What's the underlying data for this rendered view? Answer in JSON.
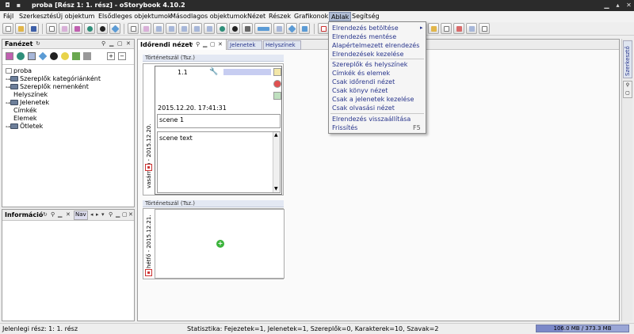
{
  "window": {
    "title": "proba [Rész 1: 1. rész] - oStorybook 4.10.2"
  },
  "menubar": {
    "items": [
      "Fájl",
      "Szerkesztés",
      "Új objektum",
      "Elsődleges objektumok",
      "Másodlagos objektumok",
      "Nézet",
      "Részek",
      "Grafikonok",
      "Ablak",
      "Segítség"
    ],
    "active": "Ablak"
  },
  "ablak_menu": {
    "items": [
      {
        "label": "Elrendezés betöltése",
        "submenu": true,
        "shortcut": ""
      },
      {
        "label": "Elrendezés mentése",
        "submenu": false,
        "shortcut": ""
      },
      {
        "label": "Alapértelmezett elrendezés",
        "submenu": false,
        "shortcut": ""
      },
      {
        "label": "Elrendezések kezelése",
        "submenu": false,
        "shortcut": ""
      },
      {
        "label": "Szereplők és helyszínek",
        "submenu": false,
        "shortcut": ""
      },
      {
        "label": "Címkék és elemek",
        "submenu": false,
        "shortcut": ""
      },
      {
        "label": "Csak időrendi nézet",
        "submenu": false,
        "shortcut": ""
      },
      {
        "label": "Csak könyv nézet",
        "submenu": false,
        "shortcut": ""
      },
      {
        "label": "Csak a jelenetek kezelése",
        "submenu": false,
        "shortcut": ""
      },
      {
        "label": "Csak olvasási nézet",
        "submenu": false,
        "shortcut": ""
      },
      {
        "label": "Elrendezés visszaállítása",
        "submenu": false,
        "shortcut": ""
      },
      {
        "label": "Frissítés",
        "submenu": false,
        "shortcut": "F5"
      }
    ]
  },
  "left_panel": {
    "title": "Fanézet",
    "tree": [
      {
        "label": "proba",
        "folder": false,
        "expander": false
      },
      {
        "label": "Szereplők kategóriánként",
        "folder": true,
        "expander": true
      },
      {
        "label": "Szereplők nemenként",
        "folder": true,
        "expander": true
      },
      {
        "label": "Helyszínek",
        "folder": false,
        "expander": false
      },
      {
        "label": "Jelenetek",
        "folder": true,
        "expander": true
      },
      {
        "label": "Címkék",
        "folder": false,
        "expander": false
      },
      {
        "label": "Elemek",
        "folder": false,
        "expander": false
      },
      {
        "label": "Ötletek",
        "folder": true,
        "expander": true
      }
    ]
  },
  "info_panel": {
    "title": "Információ",
    "tab2": "Nav"
  },
  "main_tabs": [
    {
      "label": "Időrendi nézet",
      "active": true
    },
    {
      "label": "Jelenetek",
      "active": false
    },
    {
      "label": "Helyszínek",
      "active": false
    }
  ],
  "timeline": {
    "strand_label": "Történetszál (Tsz.)",
    "card1": {
      "date_vertical": "vasárnap - 2015.12.20.",
      "scene_number": "1.1",
      "datetime": "2015.12.20. 17:41:31",
      "title": "scene 1",
      "text": "scene text"
    },
    "card2": {
      "date_vertical": "hétfő - 2015.12.21."
    }
  },
  "right_sidebar": {
    "label": "Szerkesztő"
  },
  "statusbar": {
    "current_part": "Jelenlegi rész: 1: 1. rész",
    "stats": "Statisztika: Fejezetek=1,  Jelenetek=1,  Szereplők=0,  Karakterek=10,  Szavak=2",
    "memory": "106.0 MB / 373.3 MB",
    "memory_fraction": 0.284
  },
  "colors": {
    "accent": "#27348b",
    "menu_highlight": "#aebbd3",
    "strand_bg": "#e3e8f3"
  }
}
